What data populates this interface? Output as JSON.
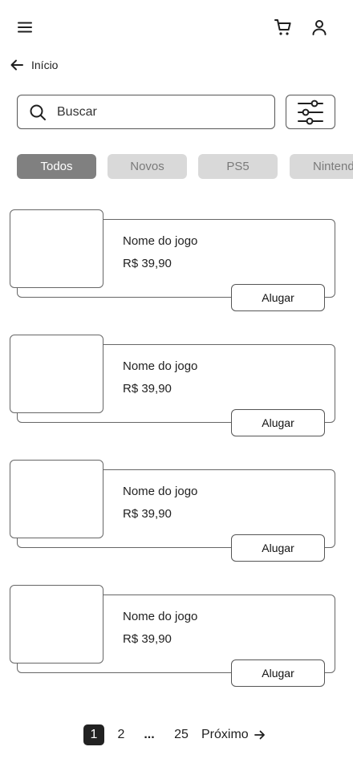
{
  "header": {
    "menu_icon": "menu-icon",
    "cart_icon": "cart-icon",
    "user_icon": "user-icon"
  },
  "breadcrumb": {
    "back_icon": "arrow-left-icon",
    "label": "Início"
  },
  "search": {
    "placeholder": "Buscar",
    "value": "",
    "icon": "search-icon"
  },
  "filter": {
    "icon": "sliders-icon"
  },
  "chips": [
    {
      "label": "Todos",
      "active": true
    },
    {
      "label": "Novos",
      "active": false
    },
    {
      "label": "PS5",
      "active": false
    },
    {
      "label": "Nintendo",
      "active": false
    }
  ],
  "products": [
    {
      "name": "Nome do jogo",
      "price": "R$ 39,90",
      "action": "Alugar"
    },
    {
      "name": "Nome do jogo",
      "price": "R$ 39,90",
      "action": "Alugar"
    },
    {
      "name": "Nome do jogo",
      "price": "R$ 39,90",
      "action": "Alugar"
    },
    {
      "name": "Nome do jogo",
      "price": "R$ 39,90",
      "action": "Alugar"
    }
  ],
  "pagination": {
    "current": "1",
    "page_2": "2",
    "ellipsis": "...",
    "last": "25",
    "next_label": "Próximo",
    "next_icon": "arrow-right-icon"
  },
  "colors": {
    "chip_active_bg": "#808080",
    "chip_bg": "#d9d9d9",
    "page_current_bg": "#222222",
    "border": "#555555"
  }
}
